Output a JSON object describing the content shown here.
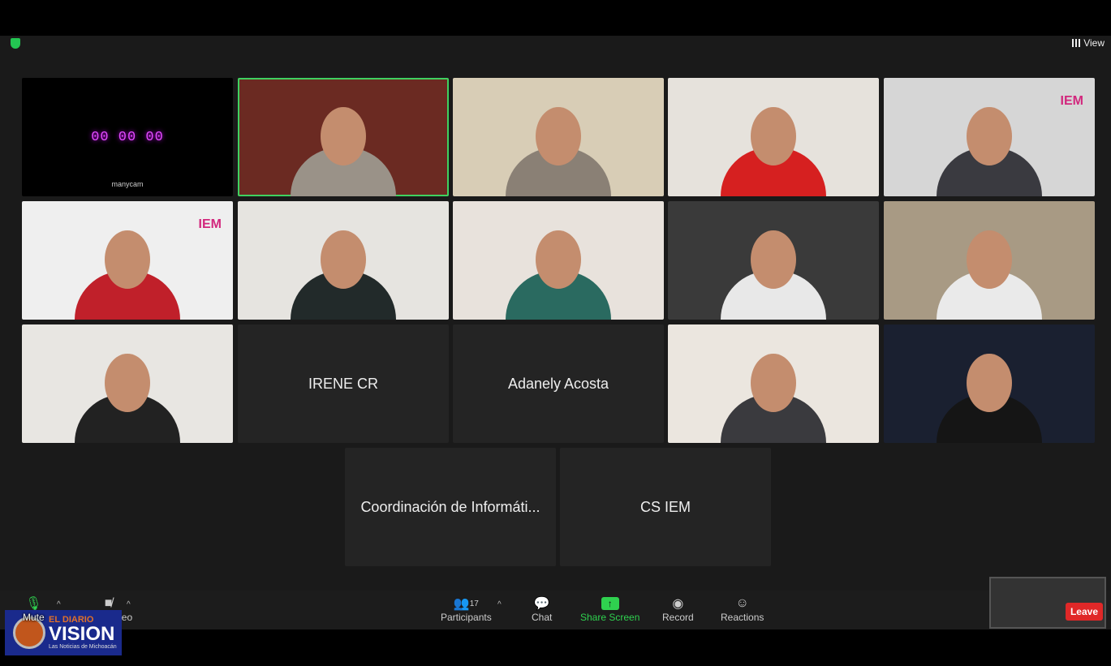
{
  "top": {
    "view_label": "View",
    "icons": [
      "shield-check-icon",
      "grid-icon"
    ]
  },
  "tiles": [
    {
      "type": "manycam",
      "timer": "00 00 00",
      "brand": "manycam",
      "bg": "#000000"
    },
    {
      "type": "video",
      "bg": "#6b2a22",
      "shirt": "#9a9288",
      "active": true
    },
    {
      "type": "video",
      "bg": "#d8cdb6",
      "shirt": "#8a8075"
    },
    {
      "type": "video",
      "bg": "#e6e2dc",
      "shirt": "#d62020"
    },
    {
      "type": "video",
      "bg": "#d6d6d6",
      "shirt": "#3a3a40",
      "logo": "IEM"
    },
    {
      "type": "video",
      "bg": "#efefef",
      "shirt": "#c0202a",
      "logo": "IEM"
    },
    {
      "type": "video",
      "bg": "#e6e4e0",
      "shirt": "#222a2a"
    },
    {
      "type": "video",
      "bg": "#e8e2dc",
      "shirt": "#2a6a60"
    },
    {
      "type": "video",
      "bg": "#3a3a3a",
      "shirt": "#e8e8e8"
    },
    {
      "type": "video",
      "bg": "#a89a84",
      "shirt": "#eaeaea"
    },
    {
      "type": "video",
      "bg": "#e8e6e2",
      "shirt": "#222222"
    },
    {
      "type": "name",
      "name": "IRENE CR"
    },
    {
      "type": "name",
      "name": "Adanely Acosta"
    },
    {
      "type": "video",
      "bg": "#ebe6df",
      "shirt": "#3a3a3e"
    },
    {
      "type": "video",
      "bg": "#1a2030",
      "shirt": "#151515"
    },
    {
      "type": "name",
      "name": "Coordinación de Informáti..."
    },
    {
      "type": "name",
      "name": "CS IEM"
    }
  ],
  "toolbar": {
    "mute": "Mute",
    "video": "Start Video",
    "participants": "Participants",
    "participant_count": "17",
    "chat": "Chat",
    "share": "Share Screen",
    "record": "Record",
    "reactions": "Reactions",
    "leave": "Leave"
  },
  "watermark": {
    "line1": "EL DIARIO",
    "line2": "VISION",
    "line3": "Las Noticias de Michoacán"
  },
  "colors": {
    "accent_green": "#2fd14f",
    "leave_red": "#e02828",
    "active_border": "#3fd160"
  }
}
